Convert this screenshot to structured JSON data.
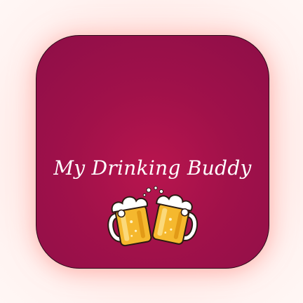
{
  "app": {
    "title": "My Drinking Buddy",
    "logo_icon": "clinking-beer-mugs-icon"
  },
  "colors": {
    "icon_background": "#a1114a",
    "page_background": "#ffe6e3",
    "title_text": "#ffffff",
    "beer": "#f5b82e",
    "foam": "#ffffff"
  }
}
